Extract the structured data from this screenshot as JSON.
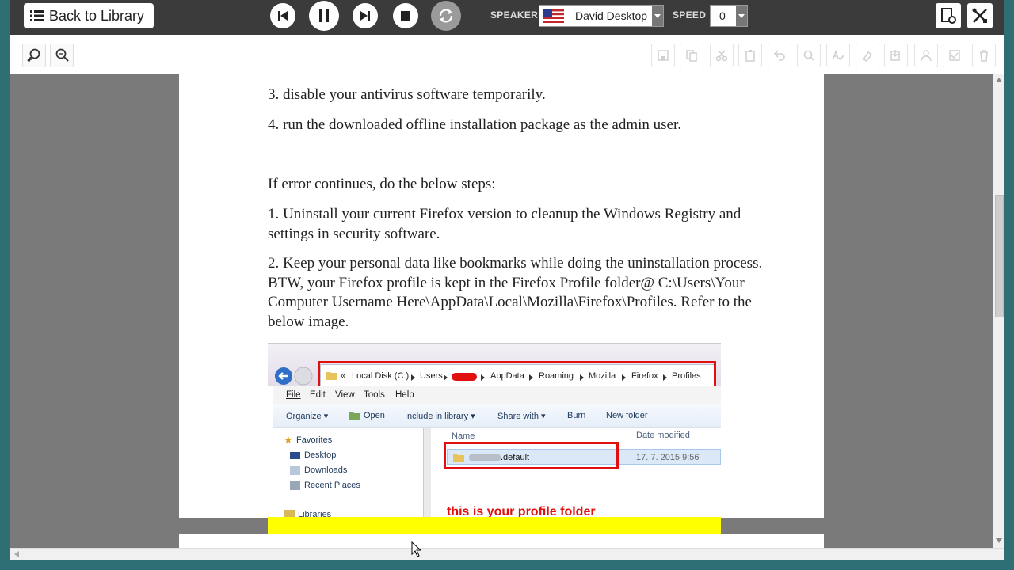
{
  "toolbar": {
    "back_label": "Back to Library",
    "speaker_label": "SPEAKER",
    "speaker_value": "David Desktop",
    "speed_label": "SPEED",
    "speed_value": "0"
  },
  "document": {
    "lines": [
      "3. disable your antivirus software temporarily.",
      "4. run the downloaded offline installation package as the admin user.",
      "If error continues, do the below steps:",
      "1. Uninstall your current Firefox version to cleanup the Windows Registry and settings in security software.",
      "2. Keep your personal data like bookmarks while doing the uninstallation process. BTW, your Firefox profile is kept in the Firefox Profile folder@ C:\\Users\\Your Computer Username Here\\AppData\\Local\\Mozilla\\Firefox\\Profiles. Refer to the below image."
    ]
  },
  "explorer": {
    "breadcrumb": [
      "«",
      "Local Disk (C:)",
      "Users",
      "AppData",
      "Roaming",
      "Mozilla",
      "Firefox",
      "Profiles"
    ],
    "menu": [
      "File",
      "Edit",
      "View",
      "Tools",
      "Help"
    ],
    "commands": [
      "Organize ▾",
      "Open",
      "Include in library ▾",
      "Share with ▾",
      "Burn",
      "New folder"
    ],
    "nav": [
      "Favorites",
      "Desktop",
      "Downloads",
      "Recent Places",
      "Libraries"
    ],
    "col_name": "Name",
    "col_date": "Date modified",
    "folder_name": ".default",
    "folder_date": "17. 7. 2015 9:56",
    "caption": "this is your profile folder"
  }
}
